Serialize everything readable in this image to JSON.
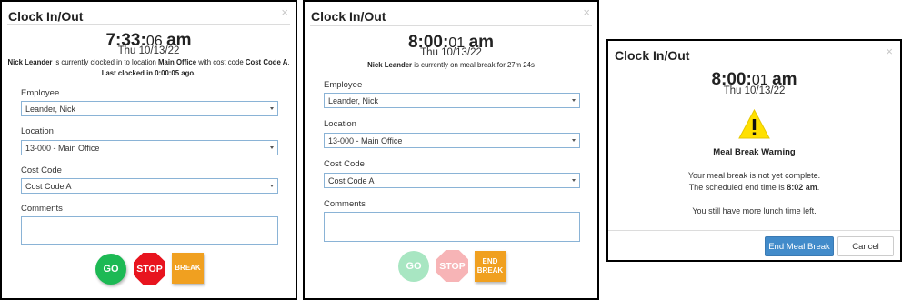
{
  "panel1": {
    "title": "Clock In/Out",
    "close": "×",
    "clock": {
      "hm": "7:33:",
      "sec": "06",
      "ampm": "am"
    },
    "date": "Thu 10/13/22",
    "status": {
      "name": "Nick Leander",
      "t1": " is currently clocked in to location ",
      "location": "Main Office",
      "t2": " with cost code ",
      "code": "Cost Code A",
      "t3": ".",
      "last": "Last clocked in 0:00:05 ago."
    },
    "employee_label": "Employee",
    "employee_value": "Leander, Nick",
    "location_label": "Location",
    "location_value": "13-000 - Main Office",
    "cost_code_label": "Cost Code",
    "cost_code_value": "Cost Code A",
    "comments_label": "Comments",
    "buttons": {
      "go": "GO",
      "stop": "STOP",
      "break": "BREAK"
    }
  },
  "panel2": {
    "title": "Clock In/Out",
    "close": "×",
    "clock": {
      "hm": "8:00:",
      "sec": "01",
      "ampm": "am"
    },
    "date": "Thu 10/13/22",
    "status": {
      "name": "Nick Leander",
      "t1": " is currently on meal break for 27m 24s"
    },
    "employee_label": "Employee",
    "employee_value": "Leander, Nick",
    "location_label": "Location",
    "location_value": "13-000 - Main Office",
    "cost_code_label": "Cost Code",
    "cost_code_value": "Cost Code A",
    "comments_label": "Comments",
    "buttons": {
      "go": "GO",
      "stop": "STOP",
      "end_break_1": "END",
      "end_break_2": "BREAK"
    }
  },
  "panel3": {
    "title": "Clock In/Out",
    "close": "×",
    "clock": {
      "hm": "8:00:",
      "sec": "01",
      "ampm": "am"
    },
    "date": "Thu 10/13/22",
    "warning_title": "Meal Break Warning",
    "line1": "Your meal break is not yet complete.",
    "line2_pre": "The scheduled end time is ",
    "line2_time": "8:02 am",
    "line2_post": ".",
    "line3": "You still have more lunch time left.",
    "end_button": "End Meal Break",
    "cancel_button": "Cancel"
  },
  "colors": {
    "go": "#1db954",
    "stop": "#e8141e",
    "break": "#f0a020",
    "go_disabled": "#a8e6c2",
    "stop_disabled": "#f7b4b6",
    "primary": "#428bca",
    "warning": "#ffe000",
    "border": "#8ab3d6"
  },
  "icons": {
    "warning": "warning-triangle-icon",
    "caret": "chevron-down-icon"
  }
}
